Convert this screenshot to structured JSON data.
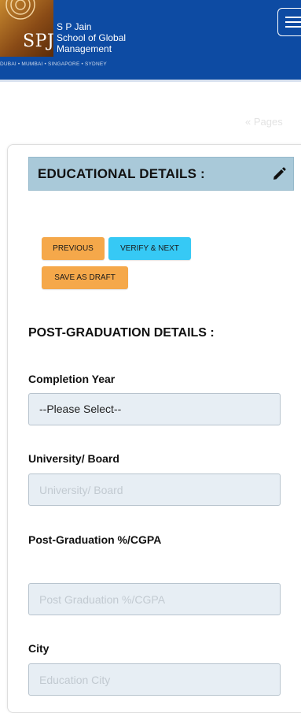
{
  "header": {
    "brand_lines": [
      "S P Jain",
      "School of Global",
      "Management"
    ],
    "logo_text": "SPJ",
    "tagline": "DUBAI • MUMBAI • SINGAPORE • SYDNEY",
    "menu_icon": "hamburger-menu-icon"
  },
  "faded_top_text": "« Pages",
  "section": {
    "title": "EDUCATIONAL DETAILS :",
    "edit_icon": "pencil-icon"
  },
  "buttons": {
    "previous": "PREVIOUS",
    "verify_next": "VERIFY & NEXT",
    "save_draft": "SAVE AS DRAFT"
  },
  "form": {
    "heading": "POST-GRADUATION DETAILS :",
    "completion_year": {
      "label": "Completion Year",
      "value": "--Please Select--"
    },
    "university": {
      "label": "University/ Board",
      "placeholder": "University/ Board"
    },
    "percentage": {
      "label": "Post-Graduation %/CGPA",
      "placeholder": "Post Graduation %/CGPA"
    },
    "city": {
      "label": "City",
      "placeholder": "Education City"
    }
  },
  "colors": {
    "header_bg": "#0d4ba3",
    "section_bar": "#a9c9d9",
    "button_orange": "#f5a84a",
    "button_blue": "#36c9f5",
    "field_bg": "#e7eef4"
  }
}
